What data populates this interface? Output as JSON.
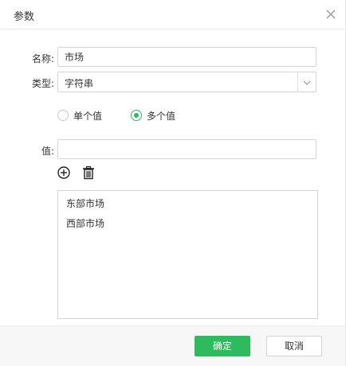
{
  "dialog": {
    "title": "参数",
    "close_icon": "close-icon"
  },
  "form": {
    "name_label": "名称:",
    "name_value": "市场",
    "type_label": "类型:",
    "type_value": "字符串",
    "type_dropdown_icon": "chevron-down-icon",
    "value_mode": {
      "options": [
        {
          "label": "单个值",
          "checked": false
        },
        {
          "label": "多个值",
          "checked": true
        }
      ]
    },
    "value_label": "值:",
    "value_input": "",
    "add_icon": "plus-circle-icon",
    "delete_icon": "trash-icon",
    "values_list": [
      "东部市场",
      "西部市场"
    ]
  },
  "footer": {
    "confirm_label": "确定",
    "cancel_label": "取消"
  },
  "colors": {
    "accent": "#2dbb5d",
    "border": "#d4d4d4",
    "footer_bg": "#f7f7f7",
    "text": "#333333"
  }
}
